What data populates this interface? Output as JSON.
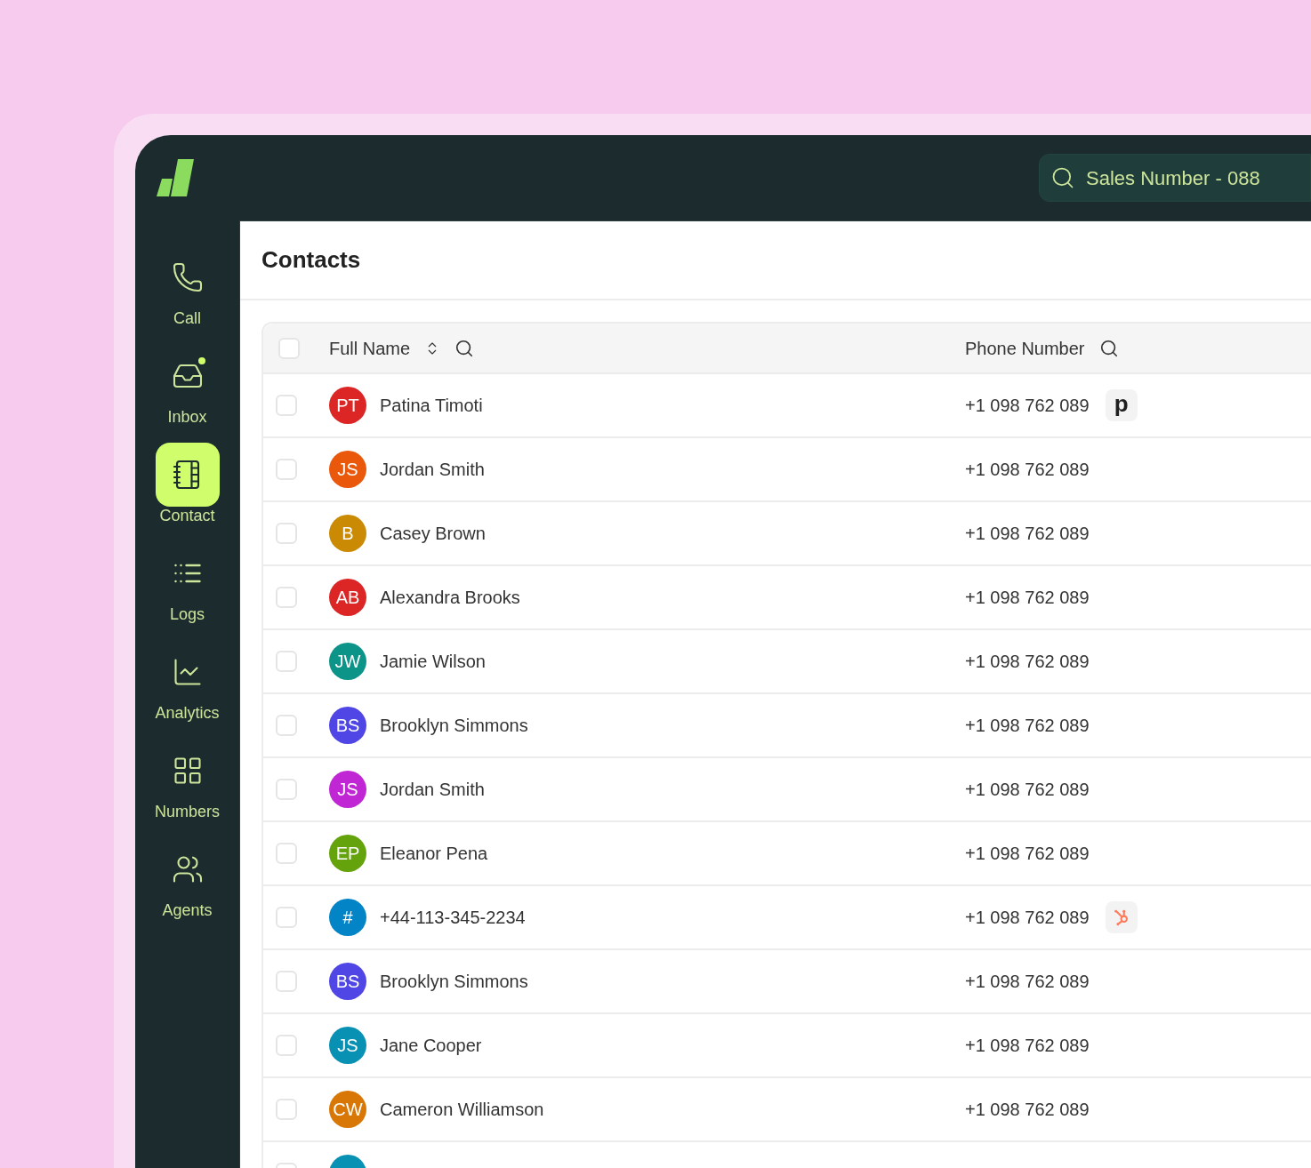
{
  "search": {
    "value": "Sales Number - 088"
  },
  "nav": [
    {
      "label": "Call",
      "selected": false,
      "notification": false
    },
    {
      "label": "Inbox",
      "selected": false,
      "notification": true
    },
    {
      "label": "Contact",
      "selected": true,
      "notification": false
    },
    {
      "label": "Logs",
      "selected": false,
      "notification": false
    },
    {
      "label": "Analytics",
      "selected": false,
      "notification": false
    },
    {
      "label": "Numbers",
      "selected": false,
      "notification": false
    },
    {
      "label": "Agents",
      "selected": false,
      "notification": false
    }
  ],
  "page_title": "Contacts",
  "table": {
    "select_all": {
      "checked": false
    },
    "columns": [
      "Full Name",
      "Phone Number"
    ],
    "rows": [
      {
        "initials": "PT",
        "color": "#dc2626",
        "name": "Patina Timoti",
        "phone": "+1 098 762 089",
        "checked": false,
        "badge": {
          "kind": "letter",
          "text": "p"
        }
      },
      {
        "initials": "JS",
        "color": "#ea580c",
        "name": "Jordan Smith",
        "phone": "+1 098 762 089",
        "checked": false
      },
      {
        "initials": "B",
        "color": "#ca8a04",
        "name": "Casey Brown",
        "phone": "+1 098 762 089",
        "checked": false
      },
      {
        "initials": "AB",
        "color": "#dc2626",
        "name": "Alexandra Brooks",
        "phone": "+1 098 762 089",
        "checked": false
      },
      {
        "initials": "JW",
        "color": "#0d9488",
        "name": "Jamie Wilson",
        "phone": "+1 098 762 089",
        "checked": false
      },
      {
        "initials": "BS",
        "color": "#4f46e5",
        "name": "Brooklyn Simmons",
        "phone": "+1 098 762 089",
        "checked": false
      },
      {
        "initials": "JS",
        "color": "#c026d3",
        "name": "Jordan Smith",
        "phone": "+1 098 762 089",
        "checked": false
      },
      {
        "initials": "EP",
        "color": "#65a30d",
        "name": "Eleanor Pena",
        "phone": "+1 098 762 089",
        "checked": false
      },
      {
        "initials": "#",
        "color": "#0284c7",
        "name": "+44-113-345-2234",
        "phone": "+1 098 762 089",
        "checked": false,
        "badge": {
          "kind": "hub"
        }
      },
      {
        "initials": "BS",
        "color": "#4f46e5",
        "name": "Brooklyn Simmons",
        "phone": "+1 098 762 089",
        "checked": false
      },
      {
        "initials": "JS",
        "color": "#0891b2",
        "name": "Jane Cooper",
        "phone": "+1 098 762 089",
        "checked": false
      },
      {
        "initials": "CW",
        "color": "#d97706",
        "name": "Cameron Williamson",
        "phone": "+1 098 762 089",
        "checked": false
      },
      {
        "color": "#0891b2",
        "checked": false
      }
    ]
  }
}
